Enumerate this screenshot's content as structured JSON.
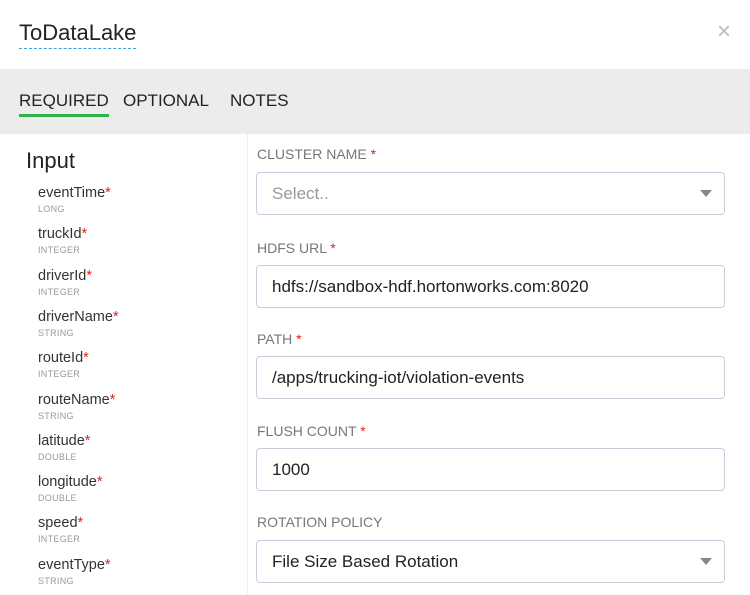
{
  "title": "ToDataLake",
  "close_label": "×",
  "tabs": [
    {
      "label": "REQUIRED"
    },
    {
      "label": "OPTIONAL"
    },
    {
      "label": "NOTES"
    }
  ],
  "input": {
    "heading": "Input",
    "fields": [
      {
        "name": "eventTime",
        "type": "LONG"
      },
      {
        "name": "truckId",
        "type": "INTEGER"
      },
      {
        "name": "driverId",
        "type": "INTEGER"
      },
      {
        "name": "driverName",
        "type": "STRING"
      },
      {
        "name": "routeId",
        "type": "INTEGER"
      },
      {
        "name": "routeName",
        "type": "STRING"
      },
      {
        "name": "latitude",
        "type": "DOUBLE"
      },
      {
        "name": "longitude",
        "type": "DOUBLE"
      },
      {
        "name": "speed",
        "type": "INTEGER"
      },
      {
        "name": "eventType",
        "type": "STRING"
      }
    ]
  },
  "required_mark": "*",
  "form": {
    "cluster_name": {
      "label": "CLUSTER NAME",
      "placeholder": "Select.."
    },
    "hdfs_url": {
      "label": "HDFS URL",
      "value": "hdfs://sandbox-hdf.hortonworks.com:8020"
    },
    "path": {
      "label": "PATH",
      "value": "/apps/trucking-iot/violation-events"
    },
    "flush_count": {
      "label": "FLUSH COUNT",
      "value": "1000"
    },
    "rotation_policy": {
      "label": "ROTATION POLICY",
      "value": "File Size Based Rotation"
    }
  }
}
